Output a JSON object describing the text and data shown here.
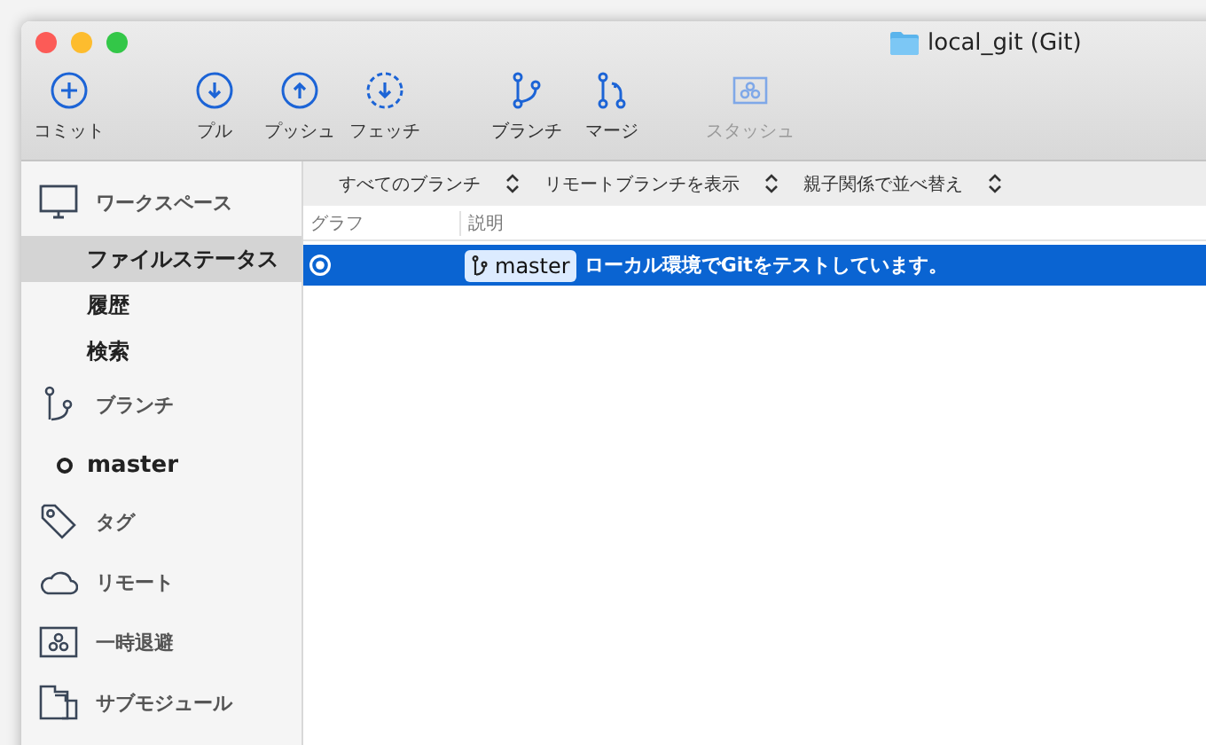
{
  "window": {
    "title": "local_git (Git)"
  },
  "toolbar": {
    "groups": [
      [
        {
          "label": "コミット",
          "disabled": false
        }
      ],
      [
        {
          "label": "プル",
          "disabled": false
        },
        {
          "label": "プッシュ",
          "disabled": false
        },
        {
          "label": "フェッチ",
          "disabled": false
        }
      ],
      [
        {
          "label": "ブランチ",
          "disabled": false
        },
        {
          "label": "マージ",
          "disabled": false
        }
      ],
      [
        {
          "label": "スタッシュ",
          "disabled": true
        }
      ]
    ]
  },
  "sidebar": {
    "sections": [
      {
        "label": "ワークスペース",
        "children": [
          {
            "label": "ファイルステータス",
            "selected": true
          },
          {
            "label": "履歴",
            "selected": false
          },
          {
            "label": "検索",
            "selected": false
          }
        ]
      },
      {
        "label": "ブランチ",
        "children": [
          {
            "label": "master",
            "selected": false
          }
        ]
      },
      {
        "label": "タグ"
      },
      {
        "label": "リモート"
      },
      {
        "label": "一時退避"
      },
      {
        "label": "サブモジュール"
      }
    ]
  },
  "filters": [
    "すべてのブランチ",
    "リモートブランチを表示",
    "親子関係で並べ替え"
  ],
  "table": {
    "columns": [
      "グラフ",
      "説明"
    ],
    "rows": [
      {
        "selected": true,
        "branch": "master",
        "message": "ローカル環境でGitをテストしています。"
      }
    ]
  }
}
